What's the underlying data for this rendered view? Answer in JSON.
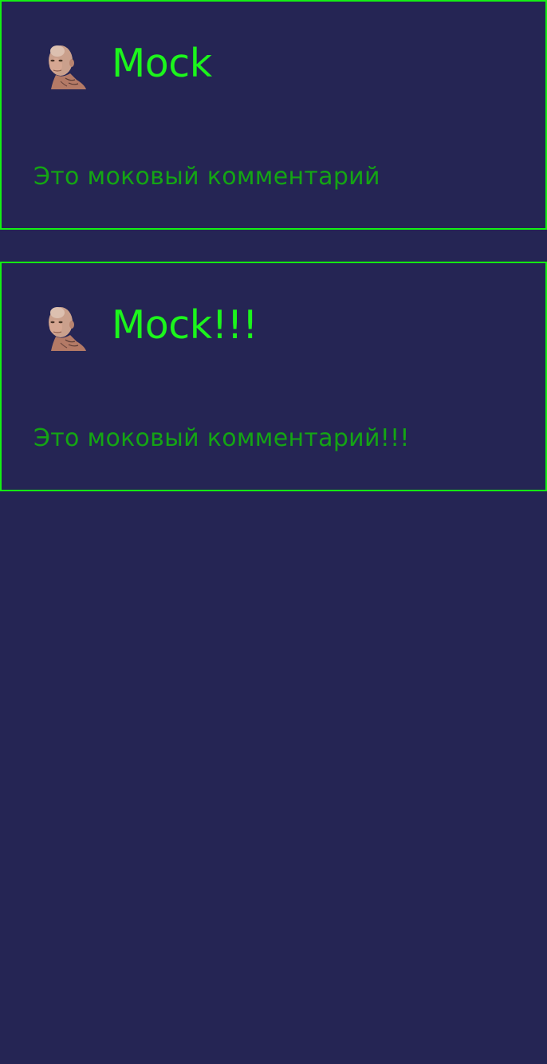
{
  "colors": {
    "background": "#252554",
    "card_border": "#14f014",
    "author_text": "#1cf51c",
    "comment_text": "#14a514"
  },
  "comments": [
    {
      "avatar_icon": "bald-man-portrait-avatar",
      "author": "Mock",
      "text": "Это моковый комментарий"
    },
    {
      "avatar_icon": "bald-man-portrait-avatar",
      "author": "Mock!!!",
      "text": "Это моковый комментарий!!!"
    }
  ]
}
